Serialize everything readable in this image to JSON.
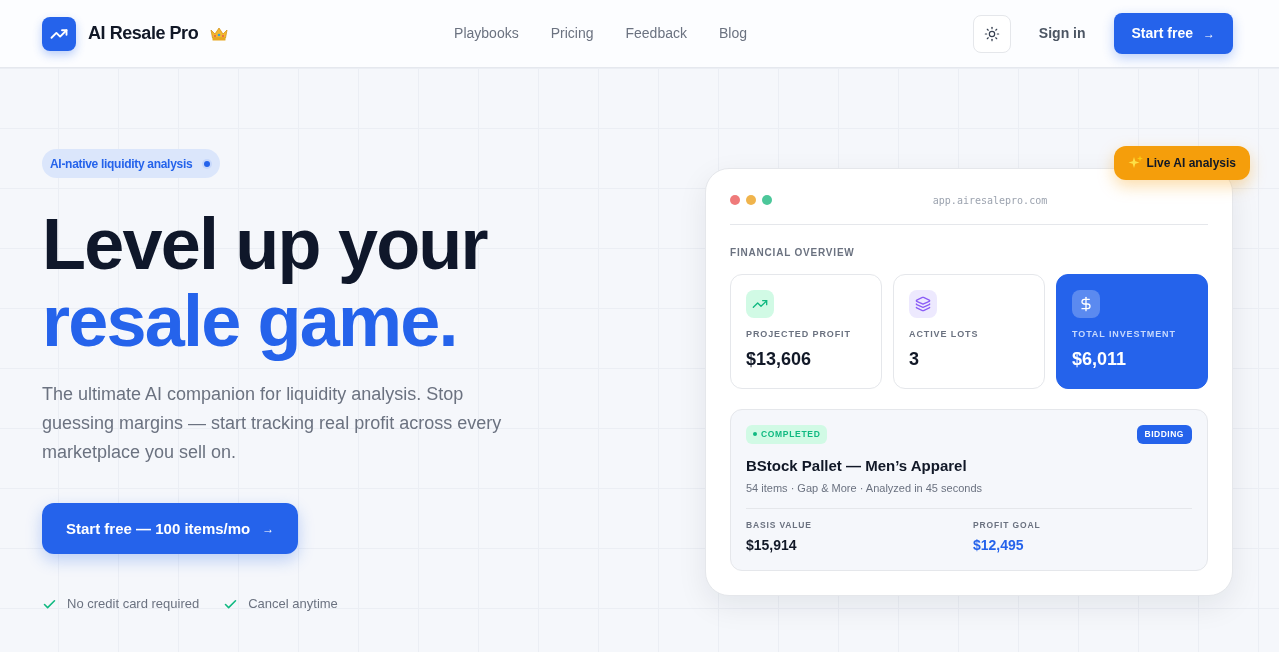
{
  "header": {
    "brand": {
      "name": "AI Resale Pro"
    },
    "nav": [
      {
        "label": "Playbooks"
      },
      {
        "label": "Pricing"
      },
      {
        "label": "Feedback"
      },
      {
        "label": "Blog"
      }
    ],
    "sign_in": "Sign in",
    "cta": {
      "label": "Start free",
      "arrow": "→"
    }
  },
  "hero": {
    "badge": {
      "label": "AI-native liquidity analysis"
    },
    "title_line_1": "Level up your",
    "title_line_2": "resale game.",
    "description": "The ultimate AI companion for liquidity analysis. Stop guessing margins — start tracking real profit across every marketplace you sell on.",
    "cta": {
      "label": "Start free — 100 items/mo",
      "arrow": "→"
    },
    "perks": [
      "No credit card required",
      "Cancel anytime"
    ]
  },
  "preview": {
    "url": "app.airesalepro.com",
    "live_badge": "Live AI analysis",
    "section_label": "FINANCIAL OVERVIEW",
    "stats": [
      {
        "kind": "profit",
        "label": "PROJECTED PROFIT",
        "value": "$13,606",
        "highlighted": false
      },
      {
        "kind": "lots",
        "label": "ACTIVE LOTS",
        "value": "3",
        "highlighted": false
      },
      {
        "kind": "investment",
        "label": "TOTAL INVESTMENT",
        "value": "$6,011",
        "highlighted": true
      }
    ],
    "lot": {
      "status": "COMPLETED",
      "tag": "BIDDING",
      "title": "BStock Pallet — Men’s Apparel",
      "meta": "54 items · Gap & More · Analyzed in 45 seconds",
      "figures": [
        {
          "kind": "basis",
          "label": "BASIS VALUE",
          "value": "$15,914"
        },
        {
          "kind": "goal",
          "label": "PROFIT GOAL",
          "value": "$12,495"
        }
      ]
    }
  }
}
